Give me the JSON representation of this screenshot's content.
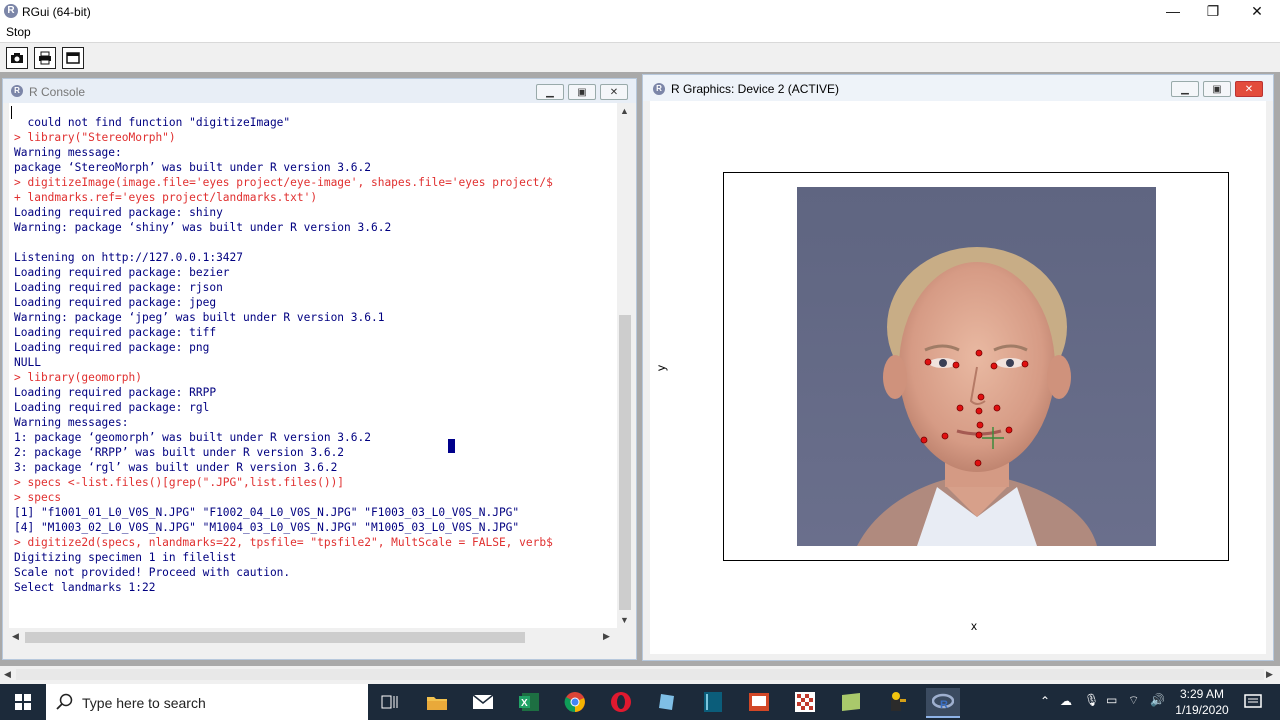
{
  "app": {
    "title": "RGui (64-bit)",
    "menu": [
      "Stop"
    ]
  },
  "window_controls": {
    "minimize": "—",
    "restore": "❐",
    "close": "✕"
  },
  "console": {
    "title": "R Console",
    "lines": [
      {
        "type": "out",
        "text": "  could not find function \"digitizeImage\""
      },
      {
        "type": "cmd",
        "text": "> library(\"StereoMorph\")"
      },
      {
        "type": "out",
        "text": "Warning message:"
      },
      {
        "type": "out",
        "text": "package ‘StereoMorph’ was built under R version 3.6.2"
      },
      {
        "type": "cmd",
        "text": "> digitizeImage(image.file='eyes project/eye-image', shapes.file='eyes project/$"
      },
      {
        "type": "cmd",
        "text": "+ landmarks.ref='eyes project/landmarks.txt')"
      },
      {
        "type": "out",
        "text": "Loading required package: shiny"
      },
      {
        "type": "out",
        "text": "Warning: package ‘shiny’ was built under R version 3.6.2"
      },
      {
        "type": "out",
        "text": ""
      },
      {
        "type": "out",
        "text": "Listening on http://127.0.0.1:3427"
      },
      {
        "type": "out",
        "text": "Loading required package: bezier"
      },
      {
        "type": "out",
        "text": "Loading required package: rjson"
      },
      {
        "type": "out",
        "text": "Loading required package: jpeg"
      },
      {
        "type": "out",
        "text": "Warning: package ‘jpeg’ was built under R version 3.6.1"
      },
      {
        "type": "out",
        "text": "Loading required package: tiff"
      },
      {
        "type": "out",
        "text": "Loading required package: png"
      },
      {
        "type": "out",
        "text": "NULL"
      },
      {
        "type": "cmd",
        "text": "> library(geomorph)"
      },
      {
        "type": "out",
        "text": "Loading required package: RRPP"
      },
      {
        "type": "out",
        "text": "Loading required package: rgl"
      },
      {
        "type": "out",
        "text": "Warning messages:"
      },
      {
        "type": "out",
        "text": "1: package ‘geomorph’ was built under R version 3.6.2"
      },
      {
        "type": "out",
        "text": "2: package ‘RRPP’ was built under R version 3.6.2"
      },
      {
        "type": "out",
        "text": "3: package ‘rgl’ was built under R version 3.6.2"
      },
      {
        "type": "cmd",
        "text": "> specs <-list.files()[grep(\".JPG\",list.files())]"
      },
      {
        "type": "cmd",
        "text": "> specs"
      },
      {
        "type": "out",
        "text": "[1] \"f1001_01_L0_V0S_N.JPG\" \"F1002_04_L0_V0S_N.JPG\" \"F1003_03_L0_V0S_N.JPG\""
      },
      {
        "type": "out",
        "text": "[4] \"M1003_02_L0_V0S_N.JPG\" \"M1004_03_L0_V0S_N.JPG\" \"M1005_03_L0_V0S_N.JPG\""
      },
      {
        "type": "cmd",
        "text": "> digitize2d(specs, nlandmarks=22, tpsfile= \"tpsfile2\", MultScale = FALSE, verb$"
      },
      {
        "type": "out",
        "text": "Digitizing specimen 1 in filelist"
      },
      {
        "type": "out",
        "text": "Scale not provided! Proceed with caution."
      },
      {
        "type": "out",
        "text": "Select landmarks 1:22"
      }
    ]
  },
  "graphics": {
    "title": "R Graphics: Device 2 (ACTIVE)",
    "xlabel": "x",
    "ylabel": "y"
  },
  "taskbar": {
    "search_placeholder": "Type here to search",
    "time": "3:29 AM",
    "date": "1/19/2020"
  }
}
